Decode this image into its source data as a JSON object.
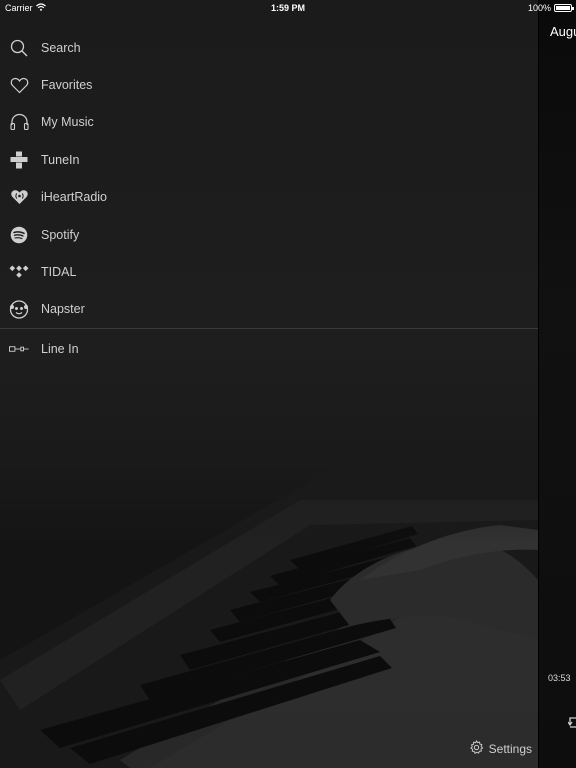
{
  "status_bar": {
    "carrier": "Carrier",
    "time": "1:59 PM",
    "battery_percent": "100%"
  },
  "sidebar": {
    "items": [
      {
        "label": "Search",
        "icon": "search-icon"
      },
      {
        "label": "Favorites",
        "icon": "heart-icon"
      },
      {
        "label": "My Music",
        "icon": "headphones-icon"
      },
      {
        "label": "TuneIn",
        "icon": "tunein-icon"
      },
      {
        "label": "iHeartRadio",
        "icon": "iheartradio-icon"
      },
      {
        "label": "Spotify",
        "icon": "spotify-icon"
      },
      {
        "label": "TIDAL",
        "icon": "tidal-icon"
      },
      {
        "label": "Napster",
        "icon": "napster-icon"
      }
    ],
    "line_in": {
      "label": "Line In",
      "icon": "line-in-icon"
    },
    "settings_label": "Settings"
  },
  "now_playing_peek": {
    "title_fragment": "Augu",
    "duration": "03:53"
  },
  "colors": {
    "background": "#1b1b1b",
    "text": "#d0d0d0",
    "divider": "#3a3a3a"
  }
}
